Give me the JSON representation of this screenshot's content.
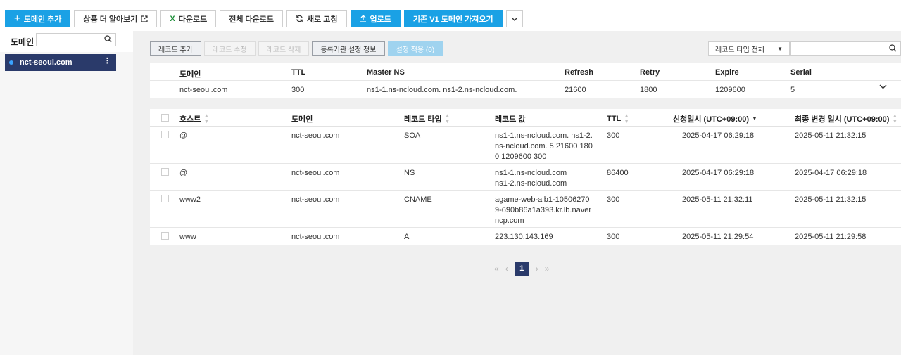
{
  "toolbar": {
    "add_domain": "도메인 추가",
    "learn_more": "상품 더 알아보기",
    "download": "다운로드",
    "download_all": "전체 다운로드",
    "refresh": "새로 고침",
    "upload": "업로드",
    "import_v1": "기존 V1 도메인 가져오기"
  },
  "sidebar": {
    "title": "도메인",
    "search_placeholder": "",
    "items": [
      {
        "label": "nct-seoul.com"
      }
    ]
  },
  "record_toolbar": {
    "add": "레코드 추가",
    "edit": "레코드 수정",
    "delete": "레코드 삭제",
    "registrar_info": "등록기관 설정 정보",
    "apply": "설정 적용 (0)",
    "type_filter": "레코드 타입 전체",
    "search_placeholder": ""
  },
  "soa": {
    "headers": [
      "도메인",
      "TTL",
      "Master NS",
      "Refresh",
      "Retry",
      "Expire",
      "Serial"
    ],
    "row": [
      "nct-seoul.com",
      "300",
      "ns1-1.ns-ncloud.com. ns1-2.ns-ncloud.com.",
      "21600",
      "1800",
      "1209600",
      "5"
    ]
  },
  "records": {
    "headers": [
      "호스트",
      "도메인",
      "레코드 타입",
      "레코드 값",
      "TTL",
      "신청일시 (UTC+09:00)",
      "최종 변경 일시 (UTC+09:00)"
    ],
    "rows": [
      {
        "host": "@",
        "domain": "nct-seoul.com",
        "type": "SOA",
        "value": "ns1-1.ns-ncloud.com. ns1-2.ns-ncloud.com. 5 21600 1800 1209600 300",
        "ttl": "300",
        "created": "2025-04-17 06:29:18",
        "modified": "2025-05-11 21:32:15"
      },
      {
        "host": "@",
        "domain": "nct-seoul.com",
        "type": "NS",
        "value": "ns1-1.ns-ncloud.com ns1-2.ns-ncloud.com",
        "ttl": "86400",
        "created": "2025-04-17 06:29:18",
        "modified": "2025-04-17 06:29:18"
      },
      {
        "host": "www2",
        "domain": "nct-seoul.com",
        "type": "CNAME",
        "value": "agame-web-alb1-105062709-690b86a1a393.kr.lb.naverncp.com",
        "ttl": "300",
        "created": "2025-05-11 21:32:11",
        "modified": "2025-05-11 21:32:15"
      },
      {
        "host": "www",
        "domain": "nct-seoul.com",
        "type": "A",
        "value": "223.130.143.169",
        "ttl": "300",
        "created": "2025-05-11 21:29:54",
        "modified": "2025-05-11 21:29:58"
      }
    ]
  },
  "pagination": {
    "current": "1"
  }
}
